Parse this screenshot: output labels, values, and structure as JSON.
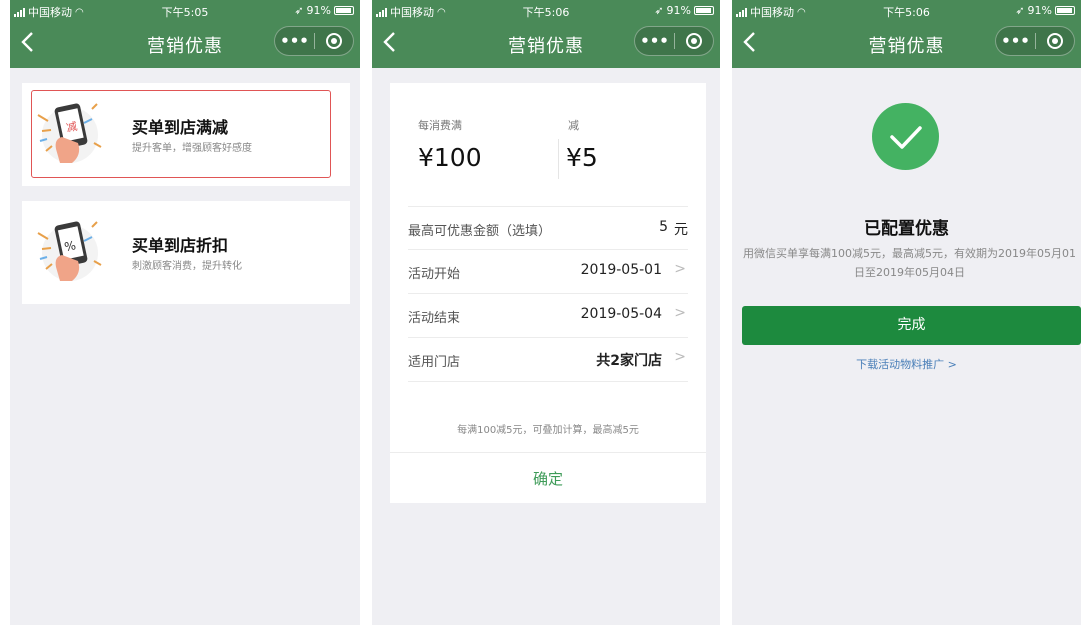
{
  "status_bars": [
    {
      "carrier": "中国移动",
      "time": "下午5:05",
      "battery": "91%"
    },
    {
      "carrier": "中国移动",
      "time": "下午5:06",
      "battery": "91%"
    },
    {
      "carrier": "中国移动",
      "time": "下午5:06",
      "battery": "91%"
    }
  ],
  "nav": {
    "title": "营销优惠",
    "more_label": "•••",
    "back_icon": "chevron-left-icon",
    "close_icon": "record-icon"
  },
  "screen1": {
    "cards": [
      {
        "title": "买单到店满减",
        "subtitle": "提升客单，增强顾客好感度",
        "icon_glyph": "减",
        "icon": "phone-discount-icon",
        "selected": true
      },
      {
        "title": "买单到店折扣",
        "subtitle": "刺激顾客消费，提升转化",
        "icon_glyph": "%",
        "icon": "phone-percent-icon",
        "selected": false
      }
    ]
  },
  "screen2": {
    "threshold_label": "每消费满",
    "threshold_value": "¥100",
    "reduce_label": "减",
    "reduce_value": "¥5",
    "rows": {
      "max": {
        "label": "最高可优惠金额（选填）",
        "value": "5",
        "unit": "元"
      },
      "start": {
        "label": "活动开始",
        "value": "2019-05-01"
      },
      "end": {
        "label": "活动结束",
        "value": "2019-05-04"
      },
      "stores": {
        "label": "适用门店",
        "value": "共2家门店"
      }
    },
    "chevron": ">",
    "note": "每满100减5元，可叠加计算，最高减5元",
    "confirm_label": "确定"
  },
  "screen3": {
    "title": "已配置优惠",
    "description": "用微信买单享每满100减5元，最高减5元，有效期为2019年05月01日至2019年05月04日",
    "done_label": "完成",
    "download_label": "下载活动物料推广 >",
    "accent_color": "#44b262"
  },
  "colors": {
    "header_green": "#4a8a58",
    "button_green": "#1d8a3e",
    "confirm_green": "#3e9b58",
    "highlight_red": "#e05555",
    "link_blue": "#4a7fb8"
  }
}
